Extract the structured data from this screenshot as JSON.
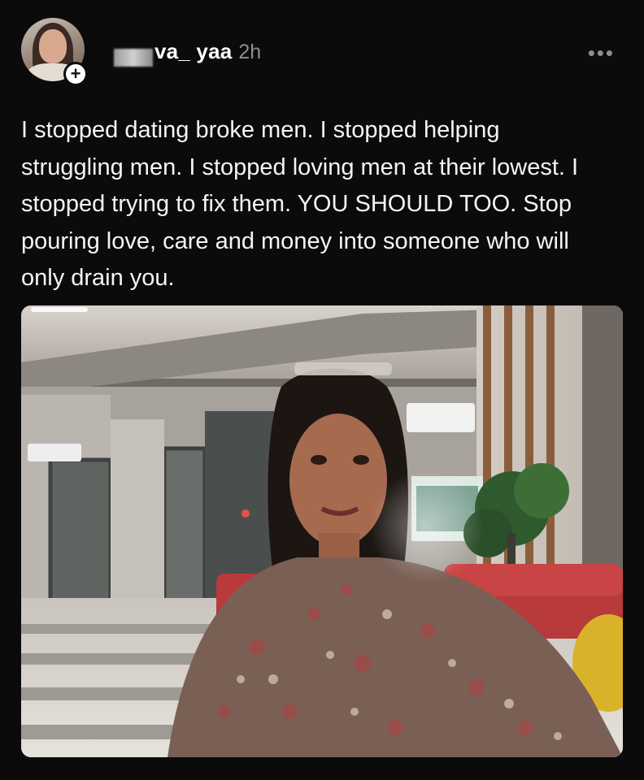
{
  "post": {
    "username": "va_ yaa",
    "timestamp": "2h",
    "more_label": "•••",
    "follow_symbol": "+",
    "caption": "I stopped dating broke men. I stopped helping struggling men. I stopped loving men at their lowest. I stopped trying to fix them. YOU SHOULD TOO. Stop pouring love, care and money into someone who will only drain you.",
    "icons": {
      "avatar": "avatar",
      "follow": "plus-icon",
      "more": "more-dots-icon"
    },
    "colors": {
      "background": "#0b0b0c",
      "text": "#f4f4f4",
      "muted": "#8e8e8e"
    }
  }
}
